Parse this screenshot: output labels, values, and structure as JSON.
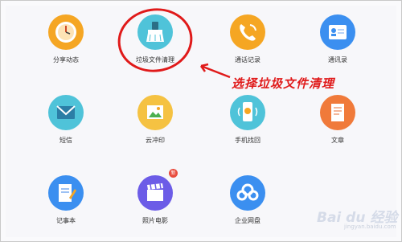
{
  "apps": [
    {
      "label": "分享动态",
      "icon": "clock-icon",
      "color": "#f5a623"
    },
    {
      "label": "垃圾文件清理",
      "icon": "broom-icon",
      "color": "#4fc3d9"
    },
    {
      "label": "通话记录",
      "icon": "phone-icon",
      "color": "#f5a623"
    },
    {
      "label": "通讯录",
      "icon": "contact-card-icon",
      "color": "#3b8ff0"
    },
    {
      "label": "短信",
      "icon": "envelope-icon",
      "color": "#4fc3d9"
    },
    {
      "label": "云冲印",
      "icon": "picture-icon",
      "color": "#f5c242"
    },
    {
      "label": "手机找回",
      "icon": "phone-locate-icon",
      "color": "#4fc3d9"
    },
    {
      "label": "文章",
      "icon": "document-icon",
      "color": "#f07a3a"
    },
    {
      "label": "记事本",
      "icon": "notepad-icon",
      "color": "#3b8ff0"
    },
    {
      "label": "照片电影",
      "icon": "clapperboard-icon",
      "color": "#6c5ce7",
      "badge": "新"
    },
    {
      "label": "企业网盘",
      "icon": "cloud-icon",
      "color": "#3b8ff0"
    }
  ],
  "annotation": {
    "text": "选择垃圾文件清理",
    "color": "#e01a1a"
  },
  "watermark": {
    "text": "Bai du 经验",
    "url": "jingyan.baidu.com"
  }
}
